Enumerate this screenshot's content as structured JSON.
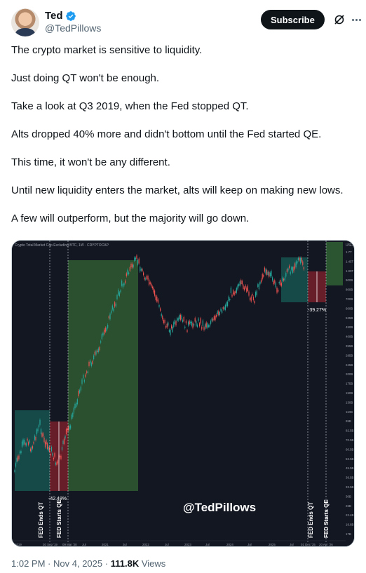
{
  "author": {
    "display_name": "Ted",
    "handle": "@TedPillows",
    "verified": true,
    "verified_color": "#1d9bf0"
  },
  "actions": {
    "subscribe_label": "Subscribe",
    "grok_icon": "grok-slash-icon",
    "more_icon": "more-dots-icon"
  },
  "tweet": {
    "lines": [
      "The crypto market is sensitive to liquidity.",
      "Just doing QT won't be enough.",
      "Take a look at Q3 2019, when the Fed stopped QT.",
      "Alts dropped 40% more and didn't bottom until the Fed started QE.",
      "This time, it won't be any different.",
      "Until new liquidity enters the market, alts will keep on making new lows.",
      "A few will outperform, but the majority will go down."
    ]
  },
  "chart_image": {
    "header_text": "Crypto Total Market Cap Excluding BTC, 1W · CRYPTOCAP",
    "currency": "USD",
    "watermark": "@TedPillows",
    "left_box_pct": "-42.48%",
    "right_box_pct": "-39.27%",
    "left_labels": [
      "FED Ends QT",
      "FED Starts QE"
    ],
    "right_labels": [
      "FED Ends QT",
      "FED Starts QE"
    ],
    "x_ticks": [
      "2019",
      "30 Sep '19",
      "09 Mar '20",
      "Jul",
      "2021",
      "Jul",
      "2022",
      "Jul",
      "2023",
      "Jul",
      "2024",
      "Jul",
      "2025",
      "Jul",
      "01 Dec '25",
      "20 Apr '26"
    ],
    "y_ticks": [
      "1.7T",
      "1.45T",
      "1.09T",
      "900B",
      "800B",
      "700B",
      "600B",
      "525B",
      "450B",
      "400B",
      "355B",
      "285B",
      "245B",
      "200B",
      "175B",
      "150B",
      "130B",
      "110B",
      "95B",
      "82.5B",
      "70.5B",
      "60.5B",
      "53.5B",
      "45.5B",
      "39.5B",
      "33.5B",
      "30B",
      "26B",
      "22.4B",
      "19.6B",
      "17B"
    ],
    "colors": {
      "background": "#131722",
      "teal_box": "#17504d",
      "red_box": "#6b1f2a",
      "green_box": "#2f5b32",
      "candle_up": "#26a69a",
      "candle_down": "#ef5350"
    }
  },
  "meta": {
    "time": "1:02 PM",
    "date": "Nov 4, 2025",
    "separator": "·",
    "views_count": "111.8K",
    "views_label": "Views"
  }
}
